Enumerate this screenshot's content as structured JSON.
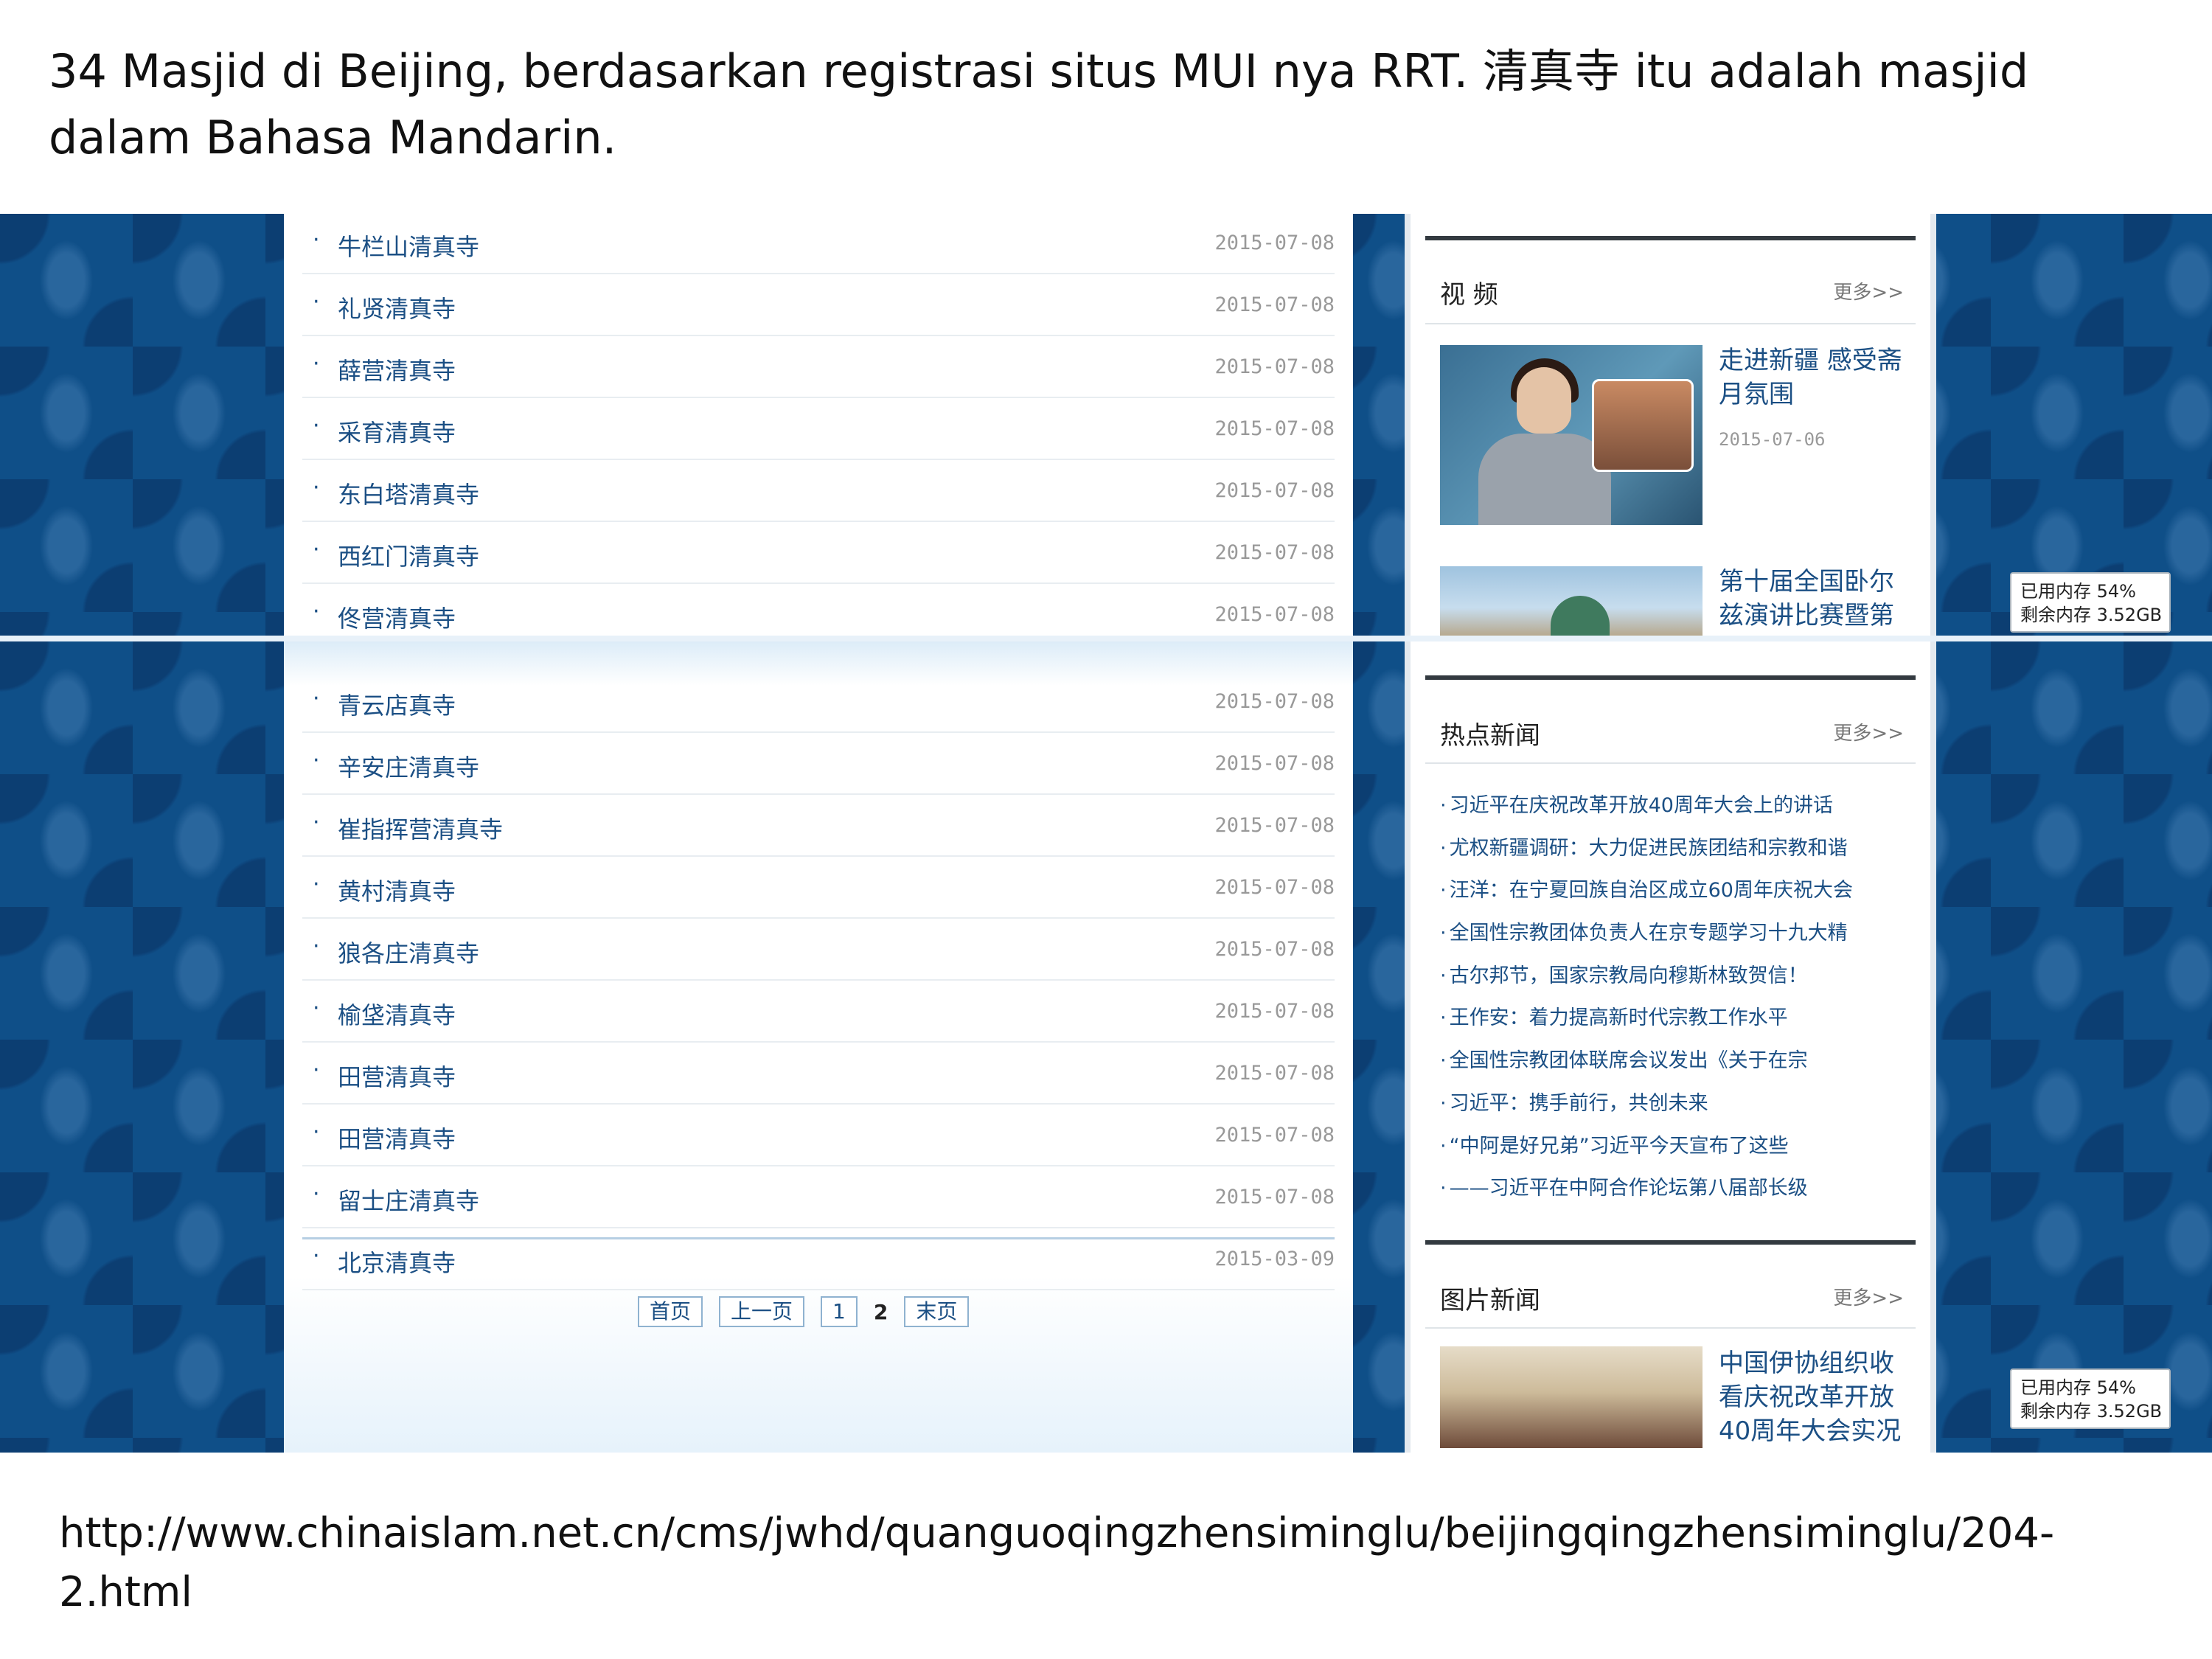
{
  "slide": {
    "title": "34 Masjid di Beijing, berdasarkan registrasi situs MUI nya RRT. 清真寺 itu adalah masjid dalam Bahasa Mandarin.",
    "source_url": "http://www.chinaislam.net.cn/cms/jwhd/quanguoqingzhensiminglu/beijingqingzhensiminglu/204-2.html"
  },
  "top_shot": {
    "mosques": [
      {
        "name": "牛栏山清真寺",
        "date": "2015-07-08"
      },
      {
        "name": "礼贤清真寺",
        "date": "2015-07-08"
      },
      {
        "name": "薛营清真寺",
        "date": "2015-07-08"
      },
      {
        "name": "采育清真寺",
        "date": "2015-07-08"
      },
      {
        "name": "东白塔清真寺",
        "date": "2015-07-08"
      },
      {
        "name": "西红门清真寺",
        "date": "2015-07-08"
      },
      {
        "name": "佟营清真寺",
        "date": "2015-07-08"
      }
    ],
    "video": {
      "title": "视 频",
      "more": "更多>>",
      "items": [
        {
          "caption": "走进新疆 感受斋月氛围",
          "date": "2015-07-06"
        },
        {
          "caption": "第十届全国卧尔兹演讲比赛暨第十一"
        }
      ]
    },
    "memory_badge": {
      "used": "已用内存 54%",
      "free": "剩余内存 3.52GB"
    }
  },
  "bottom_shot": {
    "mosques": [
      {
        "name": "青云店真寺",
        "date": "2015-07-08"
      },
      {
        "name": "辛安庄清真寺",
        "date": "2015-07-08"
      },
      {
        "name": "崔指挥营清真寺",
        "date": "2015-07-08"
      },
      {
        "name": "黄村清真寺",
        "date": "2015-07-08"
      },
      {
        "name": "狼各庄清真寺",
        "date": "2015-07-08"
      },
      {
        "name": "榆垡清真寺",
        "date": "2015-07-08"
      },
      {
        "name": "田营清真寺",
        "date": "2015-07-08"
      },
      {
        "name": "田营清真寺",
        "date": "2015-07-08"
      },
      {
        "name": "留士庄清真寺",
        "date": "2015-07-08"
      },
      {
        "name": "北京清真寺",
        "date": "2015-03-09"
      }
    ],
    "pager": {
      "first": "首页",
      "prev": "上一页",
      "page1": "1",
      "current": "2",
      "last": "末页"
    },
    "hot_news": {
      "title": "热点新闻",
      "more": "更多>>",
      "items": [
        "习近平在庆祝改革开放40周年大会上的讲话",
        "尤权新疆调研：大力促进民族团结和宗教和谐",
        "汪洋：在宁夏回族自治区成立60周年庆祝大会",
        "全国性宗教团体负责人在京专题学习十九大精",
        "古尔邦节，国家宗教局向穆斯林致贺信！",
        "王作安：着力提高新时代宗教工作水平",
        "全国性宗教团体联席会议发出《关于在宗",
        "习近平：携手前行，共创未来",
        "“中阿是好兄弟”习近平今天宣布了这些",
        "——习近平在中阿合作论坛第八届部长级"
      ]
    },
    "photo_news": {
      "title": "图片新闻",
      "more": "更多>>",
      "caption": "中国伊协组织收看庆祝改革开放40周年大会实况"
    },
    "memory_badge": {
      "used": "已用内存 54%",
      "free": "剩余内存 3.52GB"
    }
  }
}
